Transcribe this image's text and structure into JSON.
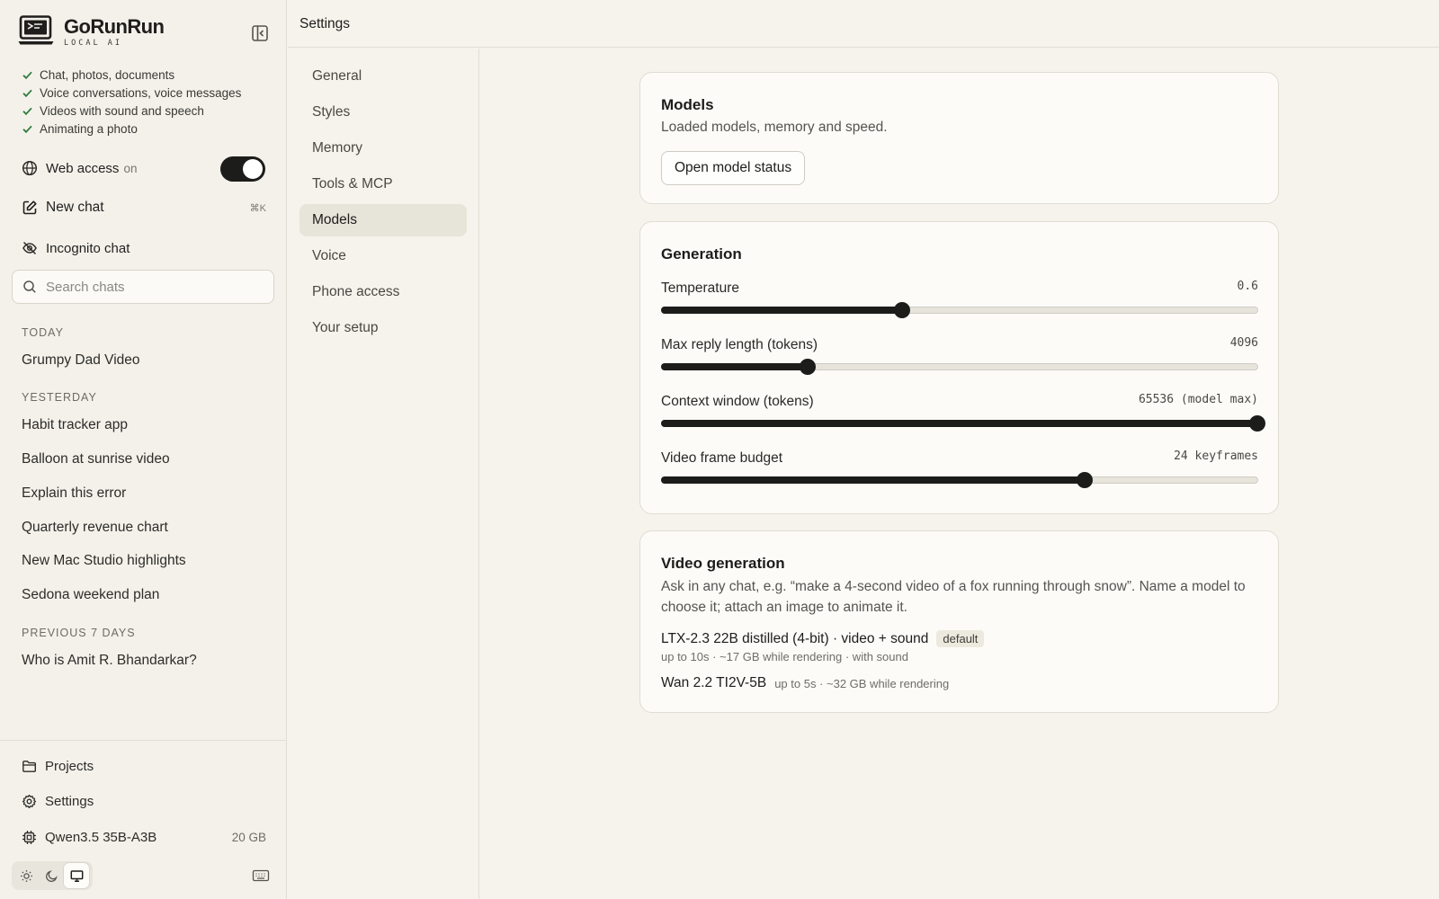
{
  "app": {
    "name": "GoRunRun",
    "subtitle": "LOCAL AI"
  },
  "sidebar": {
    "features": [
      "Chat, photos, documents",
      "Voice conversations, voice messages",
      "Videos with sound and speech",
      "Animating a photo"
    ],
    "web_access": {
      "label": "Web access",
      "state": "on",
      "enabled": true
    },
    "new_chat": {
      "label": "New chat",
      "shortcut": "⌘K"
    },
    "incognito": {
      "label": "Incognito chat"
    },
    "search": {
      "placeholder": "Search chats",
      "value": ""
    },
    "groups": [
      {
        "label": "TODAY",
        "chats": [
          "Grumpy Dad Video"
        ]
      },
      {
        "label": "YESTERDAY",
        "chats": [
          "Habit tracker app",
          "Balloon at sunrise video",
          "Explain this error",
          "Quarterly revenue chart",
          "New Mac Studio highlights",
          "Sedona weekend plan"
        ]
      },
      {
        "label": "PREVIOUS 7 DAYS",
        "chats": [
          "Who is Amit R. Bhandarkar?"
        ]
      }
    ],
    "bottom": {
      "projects": "Projects",
      "settings": "Settings",
      "model": "Qwen3.5 35B-A3B",
      "model_size": "20 GB"
    },
    "theme": {
      "options": [
        "light",
        "dark",
        "system"
      ],
      "selected": "system"
    }
  },
  "header": {
    "title": "Settings"
  },
  "settings_nav": {
    "items": [
      "General",
      "Styles",
      "Memory",
      "Tools & MCP",
      "Models",
      "Voice",
      "Phone access",
      "Your setup"
    ],
    "active": "Models"
  },
  "models_card": {
    "title": "Models",
    "description": "Loaded models, memory and speed.",
    "button": "Open model status"
  },
  "generation_card": {
    "title": "Generation",
    "sliders": [
      {
        "label": "Temperature",
        "value_text": "0.6",
        "fraction": 0.403
      },
      {
        "label": "Max reply length (tokens)",
        "value_text": "4096",
        "fraction": 0.245
      },
      {
        "label": "Context window (tokens)",
        "value_text": "65536 (model max)",
        "fraction": 1.0
      },
      {
        "label": "Video frame budget",
        "value_text": "24 keyframes",
        "fraction": 0.71
      }
    ]
  },
  "video_card": {
    "title": "Video generation",
    "description": "Ask in any chat, e.g. “make a 4-second video of a fox running through snow”. Name a model to choose it; attach an image to animate it.",
    "models": [
      {
        "name": "LTX-2.3 22B distilled (4-bit) · video + sound",
        "badge": "default",
        "meta": "up to 10s · ~17 GB while rendering · with sound"
      },
      {
        "name": "Wan 2.2 TI2V-5B",
        "meta": "up to 5s · ~32 GB while rendering"
      }
    ]
  },
  "colors": {
    "background": "#f5f3ec",
    "card": "#fcfbf8",
    "accent_dark": "#1c1c1a",
    "check_green": "#2f7a3e"
  }
}
